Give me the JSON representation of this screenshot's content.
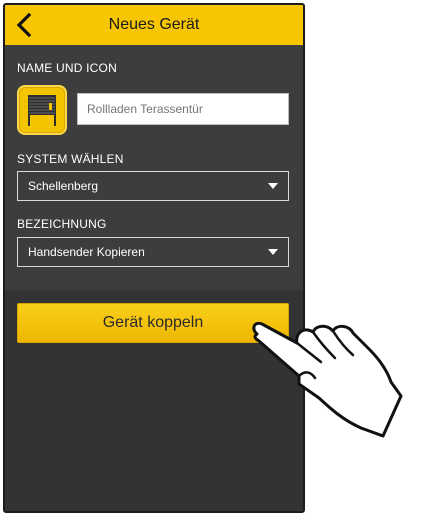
{
  "header": {
    "title": "Neues Gerät",
    "back_icon": "chevron-left-icon"
  },
  "name_section": {
    "label": "NAME UND ICON",
    "icon": "roller-shutter-icon",
    "input_placeholder": "Rollladen Terassentür",
    "input_value": ""
  },
  "system_section": {
    "label": "SYSTEM WÄHLEN",
    "selected": "Schellenberg"
  },
  "designation_section": {
    "label": "BEZEICHNUNG",
    "selected": "Handsender Kopieren"
  },
  "pair_button": {
    "label": "Gerät koppeln"
  },
  "colors": {
    "accent": "#f7c600",
    "background": "#3d3d3d",
    "text": "#ffffff"
  },
  "overlay": {
    "icon": "pointing-hand-icon"
  }
}
